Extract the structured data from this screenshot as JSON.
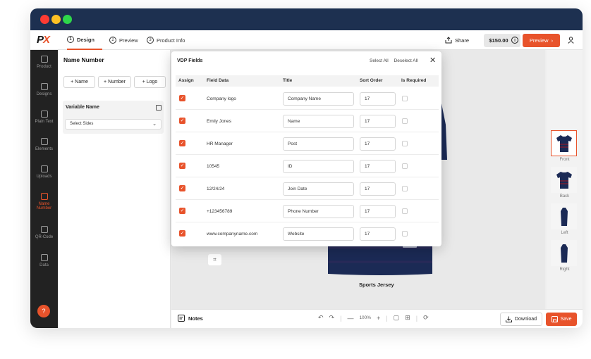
{
  "topnav": {
    "logo": "PX",
    "steps": [
      {
        "num": "1",
        "label": "Design"
      },
      {
        "num": "2",
        "label": "Preview"
      },
      {
        "num": "3",
        "label": "Product Info"
      }
    ],
    "share_label": "Share",
    "price": "$150.00",
    "preview_label": "Preview",
    "info_icon": "i"
  },
  "sidebar": {
    "items": [
      {
        "label": "Product",
        "icon": "cube-icon"
      },
      {
        "label": "Designs",
        "icon": "designs-icon"
      },
      {
        "label": "Plain Text",
        "icon": "text-icon"
      },
      {
        "label": "Elements",
        "icon": "elements-icon"
      },
      {
        "label": "Uploads",
        "icon": "upload-icon"
      },
      {
        "label": "Name Number",
        "icon": "name-number-icon"
      },
      {
        "label": "QR-Code",
        "icon": "qr-icon"
      },
      {
        "label": "Data",
        "icon": "data-icon"
      }
    ],
    "help": "?"
  },
  "panel": {
    "title": "Name Number",
    "buttons": [
      "+ Name",
      "+ Number",
      "+ Logo"
    ],
    "variable_name": "Variable Name",
    "select_sides": "Select Sides"
  },
  "modal": {
    "title": "VDP Fields",
    "select_all": "Select All",
    "deselect_all": "Deselect All",
    "close": "✕",
    "headers": [
      "Assign",
      "Field Data",
      "Title",
      "Sort Order",
      "Is Required"
    ],
    "rows": [
      {
        "field": "Company logo",
        "title": "Company Name",
        "sort": "17"
      },
      {
        "field": "Emily Jones",
        "title": "Name",
        "sort": "17"
      },
      {
        "field": "HR Manager",
        "title": "Post",
        "sort": "17"
      },
      {
        "field": "10545",
        "title": "ID",
        "sort": "17"
      },
      {
        "field": "12/24/24",
        "title": "Join Date",
        "sort": "17"
      },
      {
        "field": "+123456789",
        "title": "Phone Number",
        "sort": "17"
      },
      {
        "field": "www.companyname.com",
        "title": "Website",
        "sort": "17"
      }
    ]
  },
  "canvas": {
    "product_label": "Sports Jersey"
  },
  "views": [
    {
      "label": "Front"
    },
    {
      "label": "Back"
    },
    {
      "label": "Left"
    },
    {
      "label": "Right"
    }
  ],
  "bottom": {
    "notes_label": "Notes",
    "zoom": "100%",
    "download_label": "Download",
    "save_label": "Save"
  },
  "colors": {
    "accent": "#e8532b",
    "titlebar": "#1d3050",
    "sidebar": "#222222",
    "jersey": "#1b2a55"
  }
}
